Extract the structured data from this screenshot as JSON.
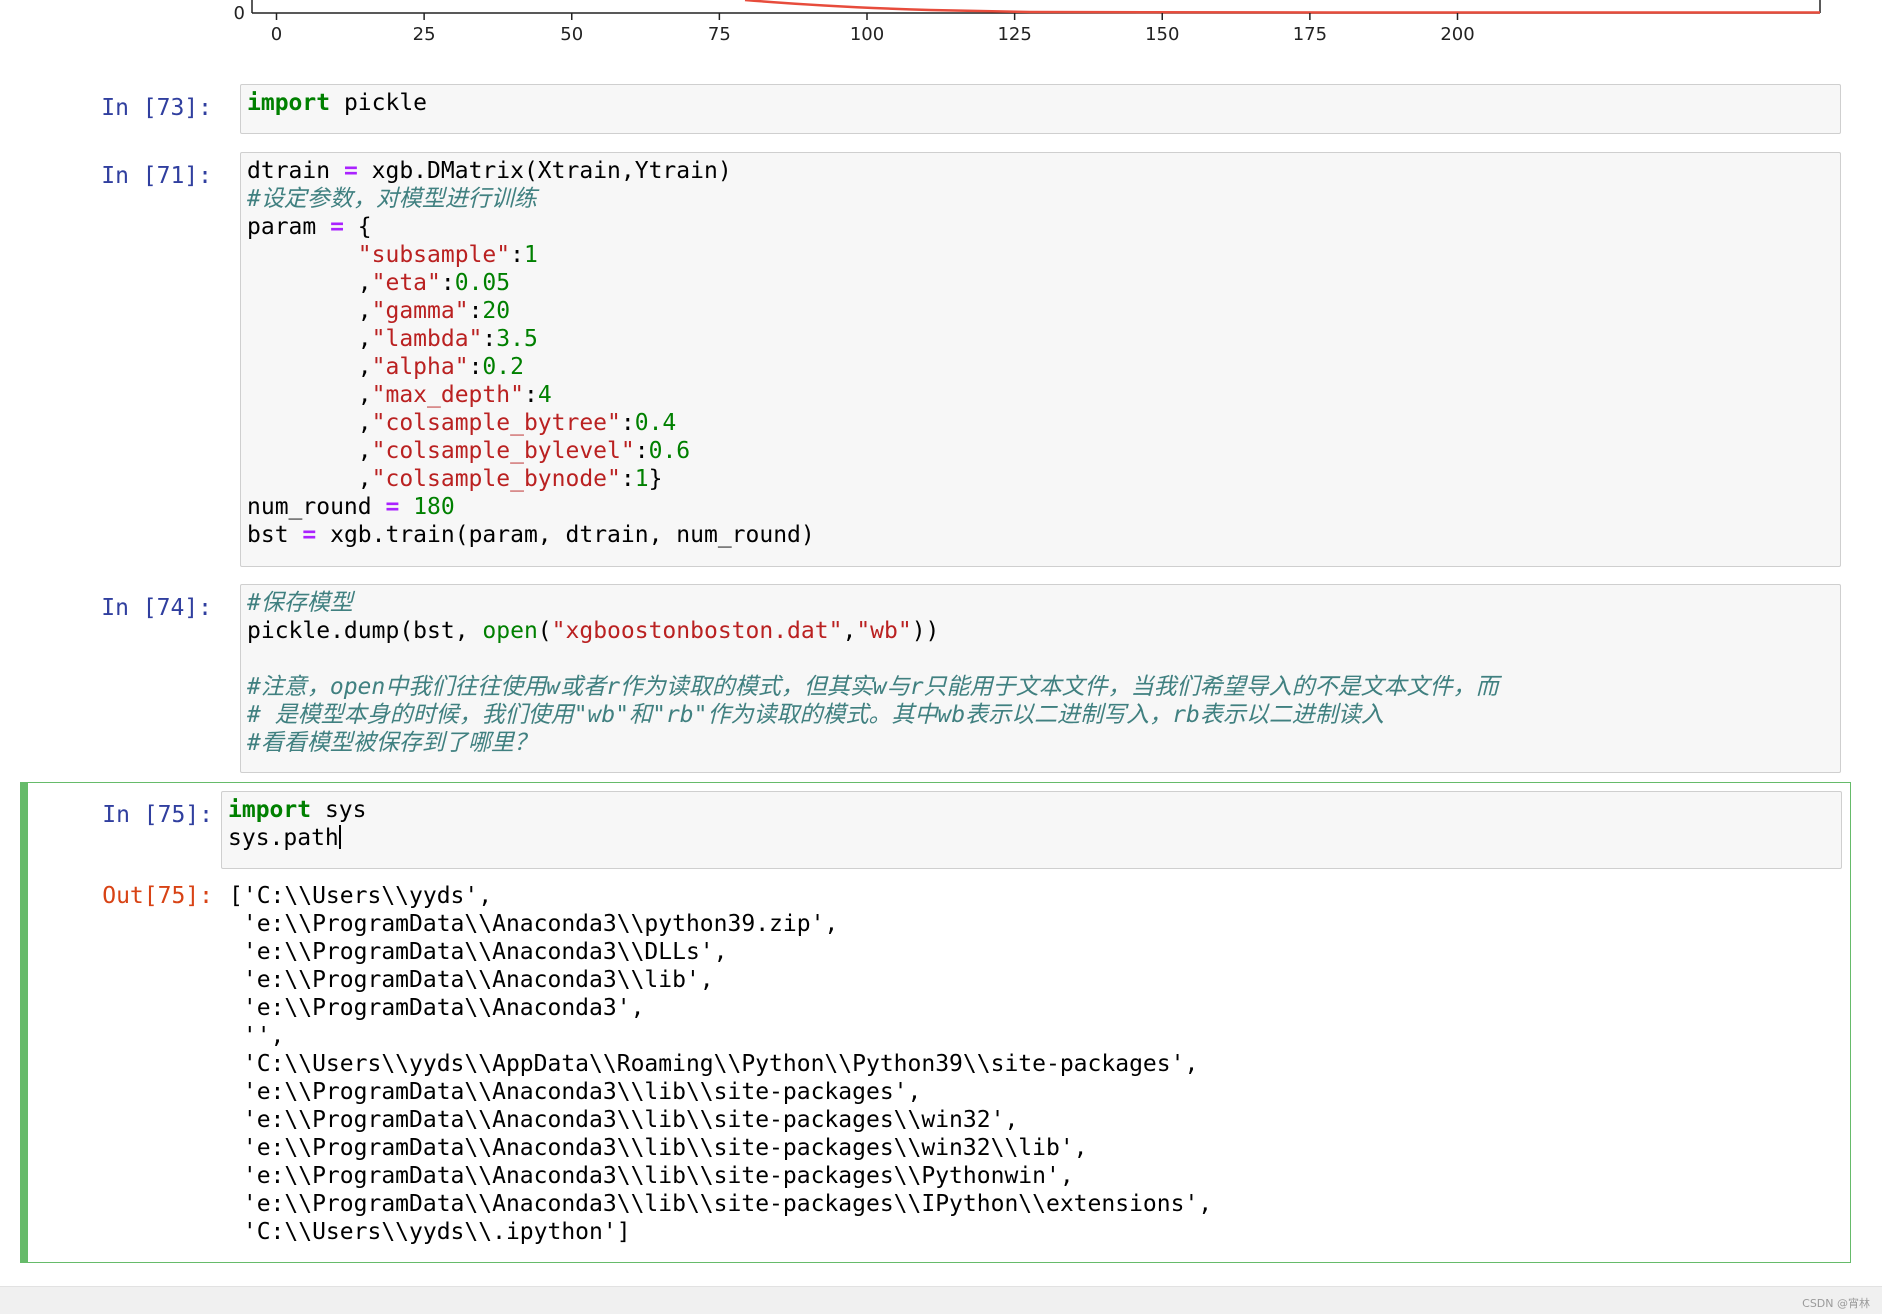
{
  "plot": {
    "y_tick_zero": "0",
    "x_ticks": [
      "0",
      "25",
      "50",
      "75",
      "100",
      "125",
      "150",
      "175",
      "200"
    ],
    "line_color": "#e74c3c"
  },
  "cells": {
    "c73": {
      "prompt": "In [73]:",
      "lines": [
        [
          {
            "t": "import",
            "c": "kw"
          },
          {
            "t": " pickle",
            "c": ""
          }
        ]
      ]
    },
    "c71": {
      "prompt": "In [71]:",
      "lines": [
        [
          {
            "t": "dtrain ",
            "c": ""
          },
          {
            "t": "=",
            "c": "op"
          },
          {
            "t": " xgb.DMatrix(Xtrain,Ytrain)",
            "c": ""
          }
        ],
        [
          {
            "t": "#设定参数，对模型进行训练",
            "c": "cm"
          }
        ],
        [
          {
            "t": "param ",
            "c": ""
          },
          {
            "t": "=",
            "c": "op"
          },
          {
            "t": " {",
            "c": ""
          }
        ],
        [
          {
            "t": "        ",
            "c": ""
          },
          {
            "t": "\"subsample\"",
            "c": "str"
          },
          {
            "t": ":",
            "c": ""
          },
          {
            "t": "1",
            "c": "num"
          }
        ],
        [
          {
            "t": "        ,",
            "c": ""
          },
          {
            "t": "\"eta\"",
            "c": "str"
          },
          {
            "t": ":",
            "c": ""
          },
          {
            "t": "0.05",
            "c": "num"
          }
        ],
        [
          {
            "t": "        ,",
            "c": ""
          },
          {
            "t": "\"gamma\"",
            "c": "str"
          },
          {
            "t": ":",
            "c": ""
          },
          {
            "t": "20",
            "c": "num"
          }
        ],
        [
          {
            "t": "        ,",
            "c": ""
          },
          {
            "t": "\"lambda\"",
            "c": "str"
          },
          {
            "t": ":",
            "c": ""
          },
          {
            "t": "3.5",
            "c": "num"
          }
        ],
        [
          {
            "t": "        ,",
            "c": ""
          },
          {
            "t": "\"alpha\"",
            "c": "str"
          },
          {
            "t": ":",
            "c": ""
          },
          {
            "t": "0.2",
            "c": "num"
          }
        ],
        [
          {
            "t": "        ,",
            "c": ""
          },
          {
            "t": "\"max_depth\"",
            "c": "str"
          },
          {
            "t": ":",
            "c": ""
          },
          {
            "t": "4",
            "c": "num"
          }
        ],
        [
          {
            "t": "        ,",
            "c": ""
          },
          {
            "t": "\"colsample_bytree\"",
            "c": "str"
          },
          {
            "t": ":",
            "c": ""
          },
          {
            "t": "0.4",
            "c": "num"
          }
        ],
        [
          {
            "t": "        ,",
            "c": ""
          },
          {
            "t": "\"colsample_bylevel\"",
            "c": "str"
          },
          {
            "t": ":",
            "c": ""
          },
          {
            "t": "0.6",
            "c": "num"
          }
        ],
        [
          {
            "t": "        ,",
            "c": ""
          },
          {
            "t": "\"colsample_bynode\"",
            "c": "str"
          },
          {
            "t": ":",
            "c": ""
          },
          {
            "t": "1",
            "c": "num"
          },
          {
            "t": "}",
            "c": ""
          }
        ],
        [
          {
            "t": "num_round ",
            "c": ""
          },
          {
            "t": "=",
            "c": "op"
          },
          {
            "t": " ",
            "c": ""
          },
          {
            "t": "180",
            "c": "num"
          }
        ],
        [
          {
            "t": "bst ",
            "c": ""
          },
          {
            "t": "=",
            "c": "op"
          },
          {
            "t": " xgb.train(param, dtrain, num_round)",
            "c": ""
          }
        ]
      ]
    },
    "c74": {
      "prompt": "In [74]:",
      "lines": [
        [
          {
            "t": "#保存模型",
            "c": "cm"
          }
        ],
        [
          {
            "t": "pickle.dump(bst, ",
            "c": ""
          },
          {
            "t": "open",
            "c": "bi"
          },
          {
            "t": "(",
            "c": ""
          },
          {
            "t": "\"xgboostonboston.dat\"",
            "c": "str"
          },
          {
            "t": ",",
            "c": ""
          },
          {
            "t": "\"wb\"",
            "c": "str"
          },
          {
            "t": "))",
            "c": ""
          }
        ],
        [
          {
            "t": " ",
            "c": ""
          }
        ],
        [
          {
            "t": "#注意，open中我们往往使用w或者r作为读取的模式，但其实w与r只能用于文本文件，当我们希望导入的不是文本文件，而",
            "c": "cm"
          }
        ],
        [
          {
            "t": "# 是模型本身的时候，我们使用\"wb\"和\"rb\"作为读取的模式。其中wb表示以二进制写入，rb表示以二进制读入",
            "c": "cm"
          }
        ],
        [
          {
            "t": "#看看模型被保存到了哪里？",
            "c": "cm"
          }
        ]
      ]
    },
    "c75": {
      "prompt": "In [75]:",
      "lines": [
        [
          {
            "t": "import",
            "c": "kw"
          },
          {
            "t": " sys",
            "c": ""
          }
        ],
        [
          {
            "t": "sys.path",
            "c": ""
          }
        ]
      ],
      "out_prompt": "Out[75]:",
      "output": [
        "['C:\\\\Users\\\\yyds',",
        " 'e:\\\\ProgramData\\\\Anaconda3\\\\python39.zip',",
        " 'e:\\\\ProgramData\\\\Anaconda3\\\\DLLs',",
        " 'e:\\\\ProgramData\\\\Anaconda3\\\\lib',",
        " 'e:\\\\ProgramData\\\\Anaconda3',",
        " '',",
        " 'C:\\\\Users\\\\yyds\\\\AppData\\\\Roaming\\\\Python\\\\Python39\\\\site-packages',",
        " 'e:\\\\ProgramData\\\\Anaconda3\\\\lib\\\\site-packages',",
        " 'e:\\\\ProgramData\\\\Anaconda3\\\\lib\\\\site-packages\\\\win32',",
        " 'e:\\\\ProgramData\\\\Anaconda3\\\\lib\\\\site-packages\\\\win32\\\\lib',",
        " 'e:\\\\ProgramData\\\\Anaconda3\\\\lib\\\\site-packages\\\\Pythonwin',",
        " 'e:\\\\ProgramData\\\\Anaconda3\\\\lib\\\\site-packages\\\\IPython\\\\extensions',",
        " 'C:\\\\Users\\\\yyds\\\\.ipython']"
      ]
    }
  },
  "watermark": "CSDN @宵林",
  "colors": {
    "prompt_in": "#303f9f",
    "prompt_out": "#d84315",
    "selected_border": "#66bb6a"
  }
}
